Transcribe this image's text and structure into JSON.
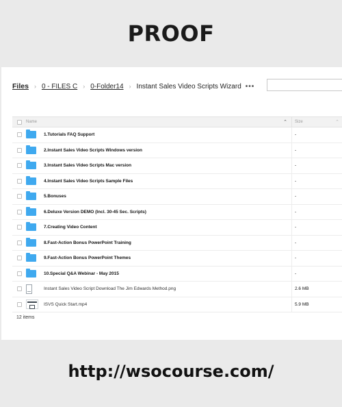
{
  "banner": {
    "title": "PROOF"
  },
  "footer": {
    "url": "http://wsocourse.com/"
  },
  "breadcrumb": {
    "root": "Files",
    "items": [
      "0 - FILES C",
      "0-Folder14"
    ],
    "current": "Instant Sales Video Scripts Wizard",
    "more": "•••"
  },
  "search": {
    "value": "",
    "placeholder": ""
  },
  "table": {
    "headers": {
      "name": "Name",
      "size": "Size"
    },
    "rows": [
      {
        "name": "1.Tutorials FAQ Support",
        "size": "-",
        "type": "folder"
      },
      {
        "name": "2.Instant Sales Video Scripts Windows version",
        "size": "-",
        "type": "folder"
      },
      {
        "name": "3.Instant Sales Video Scripts Mac version",
        "size": "-",
        "type": "folder"
      },
      {
        "name": "4.Instant Sales Video Scripts Sample Files",
        "size": "-",
        "type": "folder"
      },
      {
        "name": "5.Bonuses",
        "size": "-",
        "type": "folder"
      },
      {
        "name": "6.Deluxe Version DEMO (Incl. 30-45 Sec. Scripts)",
        "size": "-",
        "type": "folder"
      },
      {
        "name": "7.Creating Video Content",
        "size": "-",
        "type": "folder"
      },
      {
        "name": "8.Fast-Action Bonus PowerPoint Training",
        "size": "-",
        "type": "folder"
      },
      {
        "name": "9.Fast-Action Bonus PowerPoint Themes",
        "size": "-",
        "type": "folder"
      },
      {
        "name": "10.Special Q&A Webinar - May 2015",
        "size": "-",
        "type": "folder"
      },
      {
        "name": "Instant Sales Video Script Download The Jim Edwards Method.png",
        "size": "2.6 MB",
        "type": "file"
      },
      {
        "name": "ISVS Quick Start.mp4",
        "size": "5.9 MB",
        "type": "video"
      }
    ]
  },
  "status": {
    "item_count": "12 items"
  },
  "icons": {
    "folder": "folder-icon",
    "file": "file-icon",
    "video": "video-file-icon",
    "sort": "chevron-up-icon",
    "more": "more-icon"
  },
  "colors": {
    "folder": "#3fa9ef",
    "background": "#eaeaea",
    "panel": "#ffffff"
  }
}
